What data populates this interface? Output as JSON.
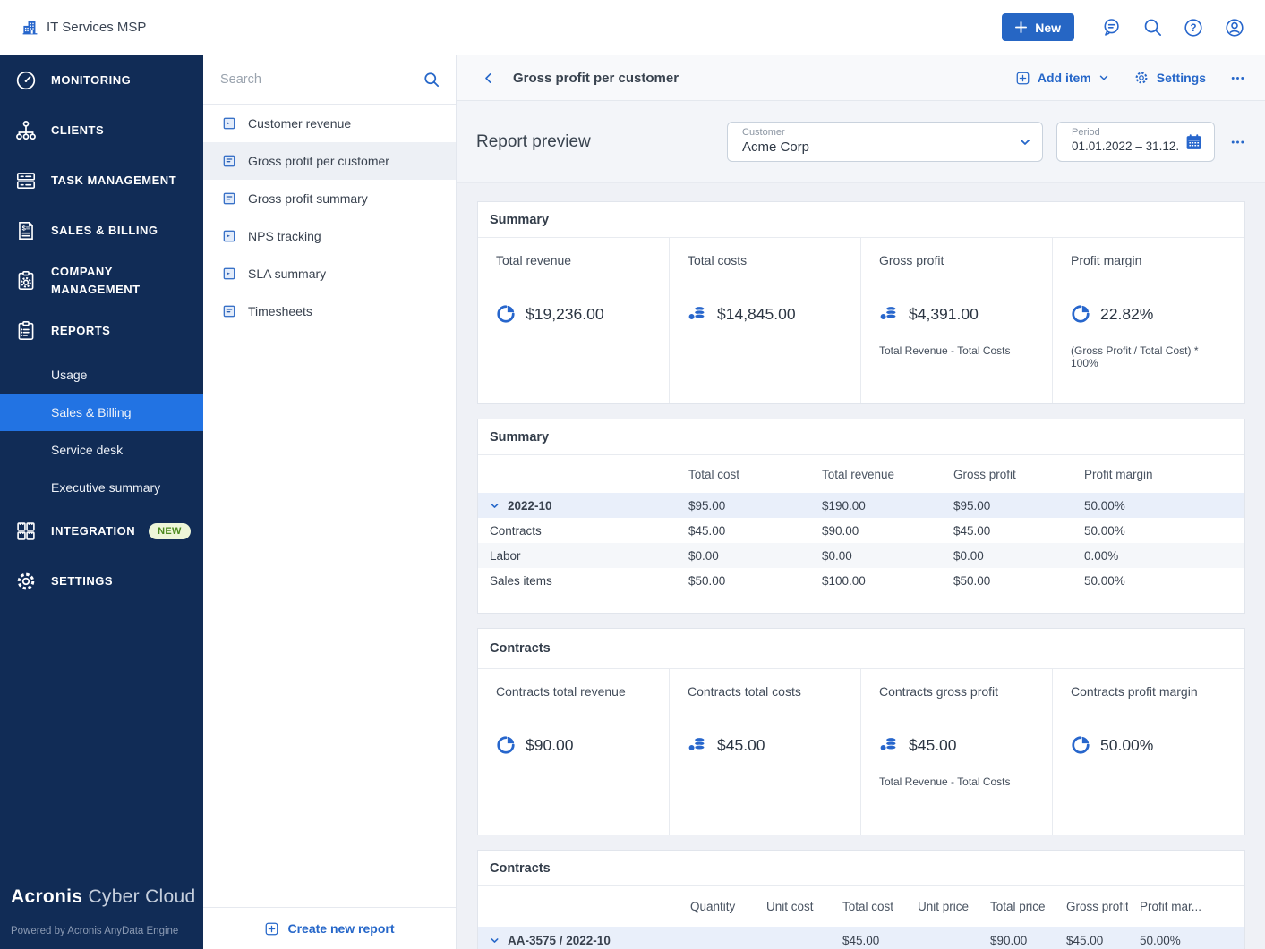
{
  "colors": {
    "accent_blue": "#2667C9",
    "sidebar_navy": "#112C56",
    "active_item_blue": "#2273E3",
    "badge_green_bg": "#EDF6D8",
    "badge_green_text": "#4C8A1F",
    "group_row_blue": "#E9EFFA"
  },
  "topbar": {
    "tenant": "IT Services MSP",
    "new_button": "New"
  },
  "nav": {
    "items": [
      {
        "label": "MONITORING"
      },
      {
        "label": "CLIENTS"
      },
      {
        "label": "TASK MANAGEMENT"
      },
      {
        "label": "SALES & BILLING"
      },
      {
        "label": "COMPANY MANAGEMENT"
      },
      {
        "label": "REPORTS"
      },
      {
        "label": "INTEGRATION",
        "badge": "NEW"
      },
      {
        "label": "SETTINGS"
      }
    ],
    "reports_sub": [
      {
        "label": "Usage",
        "active": false
      },
      {
        "label": "Sales & Billing",
        "active": true
      },
      {
        "label": "Service desk",
        "active": false
      },
      {
        "label": "Executive summary",
        "active": false
      }
    ]
  },
  "brand": {
    "name_bold": "Acronis",
    "name_light": "Cyber Cloud",
    "powered_by": "Powered by Acronis AnyData Engine"
  },
  "report_list": {
    "search_placeholder": "Search",
    "items": [
      {
        "label": "Customer revenue",
        "selected": false
      },
      {
        "label": "Gross profit per customer",
        "selected": true
      },
      {
        "label": "Gross profit summary",
        "selected": false
      },
      {
        "label": "NPS tracking",
        "selected": false
      },
      {
        "label": "SLA summary",
        "selected": false
      },
      {
        "label": "Timesheets",
        "selected": false
      }
    ],
    "create_new": "Create new report"
  },
  "header": {
    "title": "Gross profit per customer",
    "add_item": "Add item",
    "settings": "Settings"
  },
  "preview": {
    "title": "Report preview",
    "customer_label": "Customer",
    "customer_value": "Acme Corp",
    "period_label": "Period",
    "period_value": "01.01.2022 – 31.12..."
  },
  "summary_cards": {
    "title": "Summary",
    "cards": [
      {
        "label": "Total revenue",
        "icon": "pie-chart-icon",
        "value": "$19,236.00",
        "note": ""
      },
      {
        "label": "Total costs",
        "icon": "coins-icon",
        "value": "$14,845.00",
        "note": ""
      },
      {
        "label": "Gross profit",
        "icon": "coins-icon",
        "value": "$4,391.00",
        "note": "Total Revenue - Total Costs"
      },
      {
        "label": "Profit margin",
        "icon": "pie-chart-icon",
        "value": "22.82%",
        "note": "(Gross Profit / Total Cost) * 100%"
      }
    ]
  },
  "summary_table": {
    "title": "Summary",
    "columns": [
      "Total cost",
      "Total revenue",
      "Gross profit",
      "Profit margin"
    ],
    "rows": [
      {
        "label": "2022-10",
        "group": true,
        "c1": "$95.00",
        "c2": "$190.00",
        "c3": "$95.00",
        "c4": "50.00%"
      },
      {
        "label": "Contracts",
        "group": false,
        "c1": "$45.00",
        "c2": "$90.00",
        "c3": "$45.00",
        "c4": "50.00%"
      },
      {
        "label": "Labor",
        "group": false,
        "c1": "$0.00",
        "c2": "$0.00",
        "c3": "$0.00",
        "c4": "0.00%"
      },
      {
        "label": "Sales items",
        "group": false,
        "c1": "$50.00",
        "c2": "$100.00",
        "c3": "$50.00",
        "c4": "50.00%"
      }
    ]
  },
  "contracts_cards": {
    "title": "Contracts",
    "cards": [
      {
        "label": "Contracts total revenue",
        "icon": "pie-chart-icon",
        "value": "$90.00",
        "note": ""
      },
      {
        "label": "Contracts total costs",
        "icon": "coins-icon",
        "value": "$45.00",
        "note": ""
      },
      {
        "label": "Contracts gross profit",
        "icon": "coins-icon",
        "value": "$45.00",
        "note": "Total Revenue - Total Costs"
      },
      {
        "label": "Contracts profit margin",
        "icon": "pie-chart-icon",
        "value": "50.00%",
        "note": ""
      }
    ]
  },
  "contracts_table": {
    "title": "Contracts",
    "columns": [
      "Quantity",
      "Unit cost",
      "Total cost",
      "Unit price",
      "Total price",
      "Gross profit",
      "Profit mar..."
    ],
    "rows": [
      {
        "label": "AA-3575 / 2022-10",
        "group": true,
        "quantity": "",
        "unit_cost": "",
        "total_cost": "$45.00",
        "unit_price": "",
        "total_price": "$90.00",
        "gross_profit": "$45.00",
        "profit_margin": "50.00%"
      }
    ]
  }
}
